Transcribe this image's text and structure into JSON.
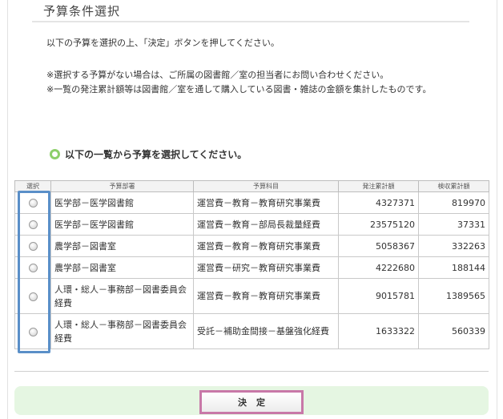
{
  "page": {
    "title": "予算条件選択",
    "intro": "以下の予算を選択の上、「決定」ボタンを押してください。",
    "notes": [
      "※選択する予算がない場合は、ご所属の図書館／室の担当者にお問い合わせください。",
      "※一覧の発注累計額等は図書館／室を通して購入している図書・雑誌の金額を集計したものです。"
    ],
    "section_heading": "以下の一覧から予算を選択してください。"
  },
  "table": {
    "headers": [
      "選択",
      "予算部署",
      "予算科目",
      "発注累計額",
      "検収累計額"
    ],
    "rows": [
      {
        "department": "医学部－医学図書館",
        "item": "運営費－教育－教育研究事業費",
        "ordered": "4327371",
        "inspected": "819970"
      },
      {
        "department": "医学部－医学図書館",
        "item": "運営費－教育－部局長裁量経費",
        "ordered": "23575120",
        "inspected": "37331"
      },
      {
        "department": "農学部－図書室",
        "item": "運営費－教育－教育研究事業費",
        "ordered": "5058367",
        "inspected": "332263"
      },
      {
        "department": "農学部－図書室",
        "item": "運営費－研究－教育研究事業費",
        "ordered": "4222680",
        "inspected": "188144"
      },
      {
        "department": "人環・総人－事務部－図書委員会経費",
        "item": "運営費－教育－教育研究事業費",
        "ordered": "9015781",
        "inspected": "1389565"
      },
      {
        "department": "人環・総人－事務部－図書委員会経費",
        "item": "受託－補助金間接－基盤強化経費",
        "ordered": "1633322",
        "inspected": "560339"
      }
    ]
  },
  "actions": {
    "decide_label": "決定"
  },
  "colors": {
    "section_icon": "#8dcf6a",
    "selection_highlight": "#5a8fc8",
    "action_bar": "#e5f6e2",
    "button_border": "#c878a8"
  },
  "icons": {
    "section_heading": "green-circle-icon"
  }
}
